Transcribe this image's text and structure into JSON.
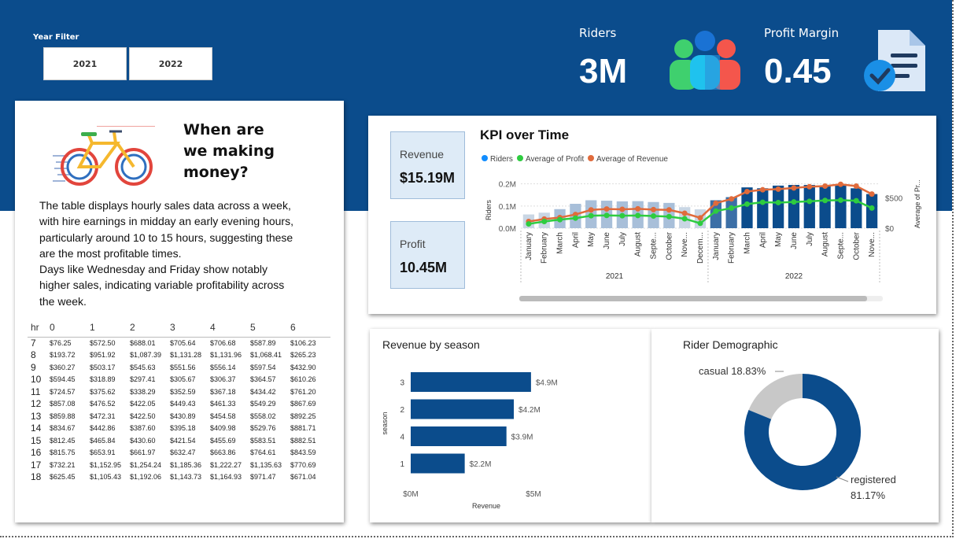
{
  "filter": {
    "label": "Year Filter",
    "options": [
      "2021",
      "2022"
    ]
  },
  "kpis": {
    "riders_label": "Riders",
    "riders_value": "3M",
    "riders_icon": "people-icon",
    "margin_label": "Profit Margin",
    "margin_value": "0.45",
    "margin_icon": "document-check-icon"
  },
  "story": {
    "icon": "bicycle-icon",
    "heading_lines": [
      "When are",
      "we making",
      "money?"
    ],
    "paragraph_lines": [
      "The table displays hourly sales data across a week,",
      "with hire earnings in midday an early evening hours,",
      "particularly around 10 to 15 hours, suggesting these",
      "are the most profitable times.",
      "Days like Wednesday and Friday show notably",
      "higher sales, indicating variable profitability across",
      "the week."
    ]
  },
  "hourly_table": {
    "headers": [
      "hr",
      "0",
      "1",
      "2",
      "3",
      "4",
      "5",
      "6"
    ],
    "rows": [
      [
        "7",
        "$76.25",
        "$572.50",
        "$688.01",
        "$705.64",
        "$706.68",
        "$587.89",
        "$106.23"
      ],
      [
        "8",
        "$193.72",
        "$951.92",
        "$1,087.39",
        "$1,131.28",
        "$1,131.96",
        "$1,068.41",
        "$265.23"
      ],
      [
        "9",
        "$360.27",
        "$503.17",
        "$545.63",
        "$551.56",
        "$556.14",
        "$597.54",
        "$432.90"
      ],
      [
        "10",
        "$594.45",
        "$318.89",
        "$297.41",
        "$305.67",
        "$306.37",
        "$364.57",
        "$610.26"
      ],
      [
        "11",
        "$724.57",
        "$375.62",
        "$338.29",
        "$352.59",
        "$367.18",
        "$434.42",
        "$761.20"
      ],
      [
        "12",
        "$857.08",
        "$476.52",
        "$422.05",
        "$449.43",
        "$461.33",
        "$549.29",
        "$867.69"
      ],
      [
        "13",
        "$859.88",
        "$472.31",
        "$422.50",
        "$430.89",
        "$454.58",
        "$558.02",
        "$892.25"
      ],
      [
        "14",
        "$834.67",
        "$442.86",
        "$387.60",
        "$395.18",
        "$409.98",
        "$529.76",
        "$881.71"
      ],
      [
        "15",
        "$812.45",
        "$465.84",
        "$430.60",
        "$421.54",
        "$455.69",
        "$583.51",
        "$882.51"
      ],
      [
        "16",
        "$815.75",
        "$653.91",
        "$661.97",
        "$632.47",
        "$663.86",
        "$764.61",
        "$843.59"
      ],
      [
        "17",
        "$732.21",
        "$1,152.95",
        "$1,254.24",
        "$1,185.36",
        "$1,222.27",
        "$1,135.63",
        "$770.69"
      ],
      [
        "18",
        "$625.45",
        "$1,105.43",
        "$1,192.06",
        "$1,143.73",
        "$1,164.93",
        "$971.47",
        "$671.04"
      ]
    ]
  },
  "kpi_cards": {
    "revenue_label": "Revenue",
    "revenue_value": "$15.19M",
    "profit_label": "Profit",
    "profit_value": "10.45M"
  },
  "colors": {
    "navy": "#0b4c8c",
    "bar_light": "#b9c9dc",
    "bar_mid": "#5f87b3",
    "green": "#2ecc40",
    "orange": "#e06b3c",
    "riders_dot": "#118dff"
  },
  "chart_data": [
    {
      "type": "bar",
      "title": "KPI over Time",
      "legend": [
        "Riders",
        "Average of Profit",
        "Average of Revenue"
      ],
      "legend_position": "top-left",
      "ylabel": "Riders",
      "y2label": "Average of Pr...",
      "y_ticks": [
        "0.0M",
        "0.1M",
        "0.2M"
      ],
      "y2_ticks": [
        "$0",
        "$500"
      ],
      "ylim": [
        0,
        0.22
      ],
      "y2lim": [
        0,
        800
      ],
      "categories": [
        "January",
        "February",
        "March",
        "April",
        "May",
        "June",
        "July",
        "August",
        "Septe...",
        "October",
        "Nove...",
        "Decem...",
        "January",
        "February",
        "March",
        "April",
        "May",
        "June",
        "July",
        "August",
        "Septe...",
        "October",
        "Nove..."
      ],
      "years": [
        {
          "label": "2021",
          "from": 0,
          "to": 11
        },
        {
          "label": "2022",
          "from": 12,
          "to": 22
        }
      ],
      "riders_values": [
        0.062,
        0.07,
        0.086,
        0.11,
        0.126,
        0.124,
        0.121,
        0.122,
        0.118,
        0.114,
        0.095,
        0.085,
        0.126,
        0.14,
        0.184,
        0.18,
        0.192,
        0.195,
        0.195,
        0.19,
        0.195,
        0.18,
        0.154
      ],
      "series": [
        {
          "name": "Average of Profit",
          "values": [
            70,
            110,
            140,
            165,
            205,
            210,
            205,
            208,
            200,
            190,
            155,
            80,
            280,
            330,
            395,
            425,
            420,
            430,
            440,
            455,
            460,
            450,
            330
          ]
        },
        {
          "name": "Average of Revenue",
          "values": [
            110,
            150,
            175,
            225,
            300,
            315,
            310,
            318,
            305,
            300,
            245,
            170,
            410,
            480,
            600,
            630,
            640,
            660,
            680,
            690,
            720,
            690,
            560
          ]
        }
      ]
    },
    {
      "type": "bar",
      "orientation": "horizontal",
      "title": "Revenue by season",
      "categories": [
        "3",
        "2",
        "4",
        "1"
      ],
      "values": [
        4.9,
        4.2,
        3.9,
        2.2
      ],
      "data_labels": [
        "$4.9M",
        "$4.2M",
        "$3.9M",
        "$2.2M"
      ],
      "xlabel": "Revenue",
      "ylabel": "season",
      "x_ticks": [
        "$0M",
        "$5M"
      ],
      "xlim": [
        0,
        5
      ]
    },
    {
      "type": "pie",
      "title": "Rider Demographic",
      "slices": [
        {
          "label": "casual",
          "percent": "18.83%",
          "value": 18.83,
          "color": "#c8c8c8"
        },
        {
          "label": "registered",
          "percent": "81.17%",
          "value": 81.17,
          "color": "#0b4c8c"
        }
      ]
    }
  ]
}
